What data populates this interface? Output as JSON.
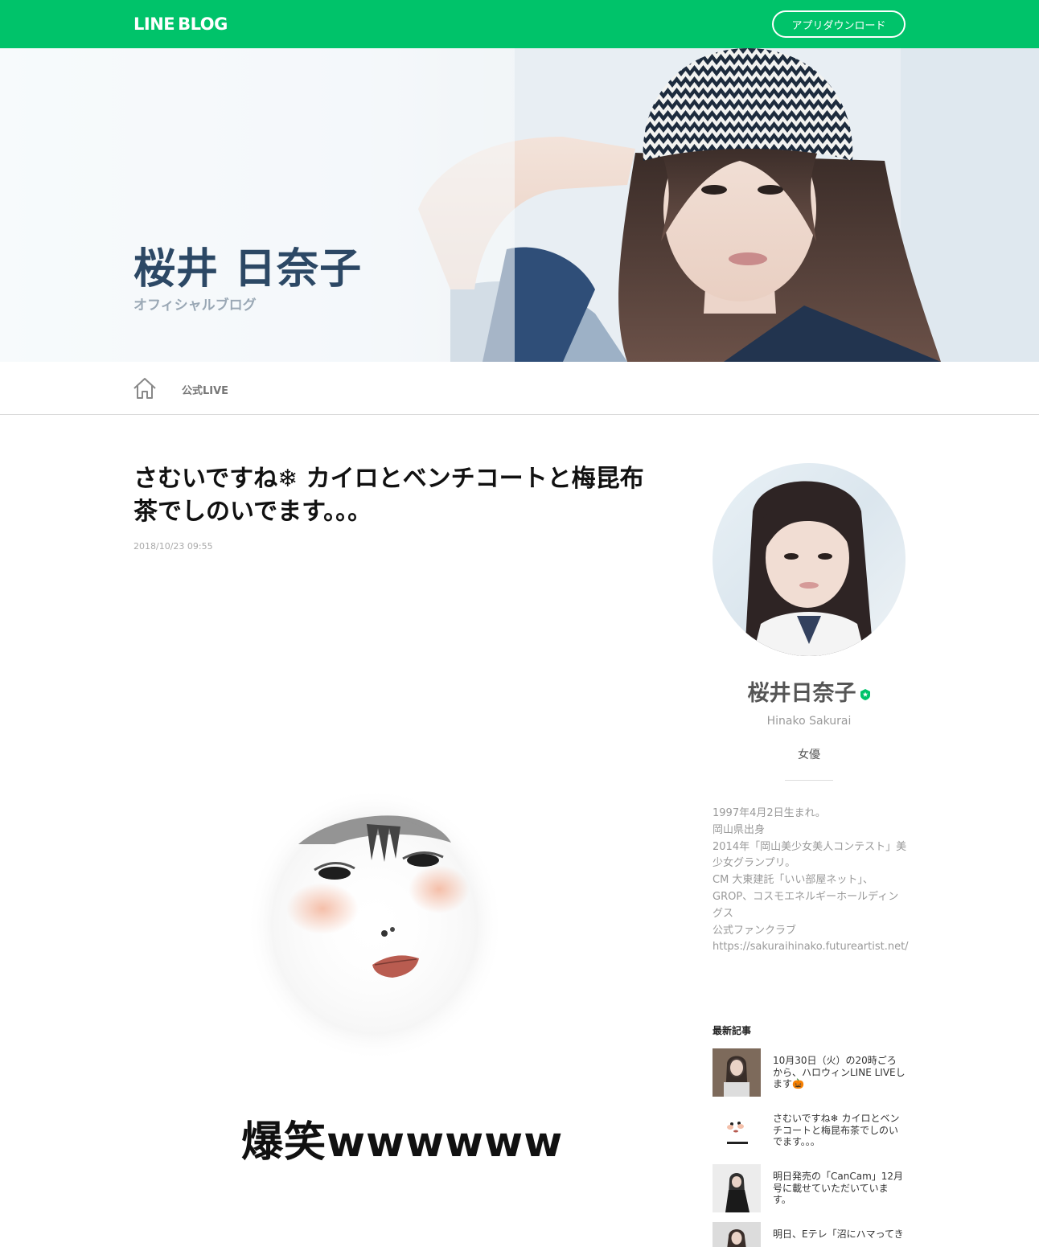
{
  "header": {
    "logo_line": "LINE",
    "logo_blog": "BLOG",
    "download_button": "アプリダウンロード"
  },
  "hero": {
    "blog_title": "桜井 日奈子",
    "blog_subtitle": "オフィシャルブログ"
  },
  "nav": {
    "home_icon": "home-icon",
    "live_label": "公式LIVE"
  },
  "article": {
    "title": "さむいですね❄ カイロとベンチコートと梅昆布茶でしのいでます。。。",
    "date": "2018/10/23 09:55",
    "image_caption": "爆笑wwwwww"
  },
  "profile": {
    "name": "桜井日奈子",
    "name_en": "Hinako Sakurai",
    "role": "女優",
    "verified_icon": "verified-badge-icon",
    "description": "1997年4月2日生まれ。\n岡山県出身\n2014年「岡山美少女美人コンテスト」美少女グランプリ。\nCM 大東建託「いい部屋ネット」、GROP、コスモエネルギーホールディングス\n公式ファンクラブ\nhttps://sakuraihinako.futureartist.net/"
  },
  "recent": {
    "heading": "最新記事",
    "items": [
      {
        "text": "10月30日（火）の20時ごろから、ハロウィンLINE LIVEします🎃"
      },
      {
        "text": "さむいですね❄ カイロとベンチコートと梅昆布茶でしのいでます。。。"
      },
      {
        "text": "明日発売の「CanCam」12月号に載せていただいています。"
      },
      {
        "text": "明日、Eテレ「沼にハマってき"
      }
    ]
  },
  "colors": {
    "brand_green": "#00c36a",
    "title_navy": "#2c4865"
  }
}
